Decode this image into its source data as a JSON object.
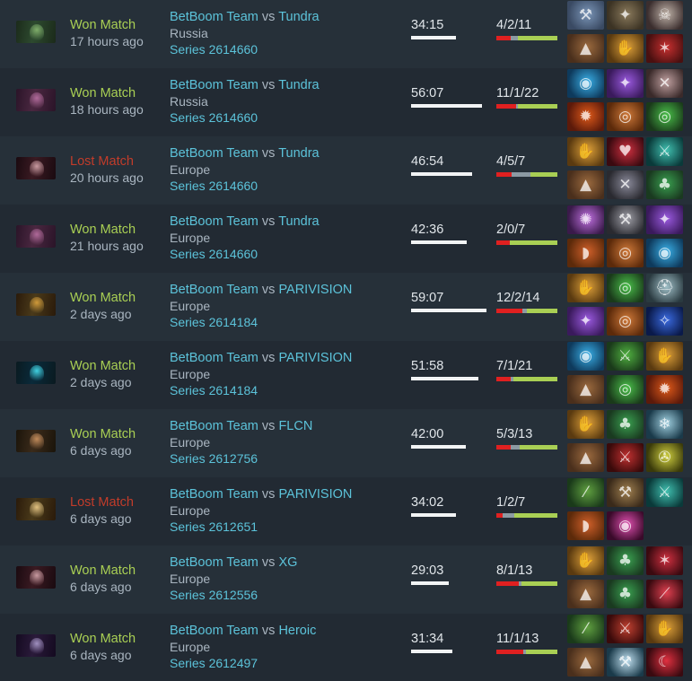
{
  "matches": [
    {
      "hero_icon": "naga-siren-icon",
      "hero_colors": [
        "#2d4a2f",
        "#7fae6a",
        "#1b2a1a"
      ],
      "result": "Won Match",
      "outcome": "win",
      "time_ago": "17 hours ago",
      "team_a": "BetBoom Team",
      "vs": "vs",
      "team_b": "Tundra",
      "region": "Russia",
      "series": "Series 2614660",
      "duration": "34:15",
      "duration_fraction": 0.56,
      "kda": "4/2/11",
      "kills": 4,
      "deaths": 2,
      "assists": 11,
      "items": [
        {
          "icon": "hammer-item-icon",
          "colors": [
            "#3a4a63",
            "#7b96b8"
          ],
          "glyph": "⚒"
        },
        {
          "icon": "glimmer-cape-icon",
          "colors": [
            "#3c3324",
            "#8a7a5c"
          ],
          "glyph": "✦"
        },
        {
          "icon": "skull-item-icon",
          "colors": [
            "#3b2e2e",
            "#bfb2a8"
          ],
          "glyph": "☠"
        },
        {
          "icon": "boots-icon",
          "colors": [
            "#4a2f1c",
            "#9b6a3e"
          ],
          "glyph": "▲"
        },
        {
          "icon": "hand-of-midas-icon",
          "colors": [
            "#5a3a10",
            "#e0a23a"
          ],
          "glyph": "✋"
        },
        {
          "icon": "red-bladed-item-icon",
          "colors": [
            "#4a1010",
            "#c93030"
          ],
          "glyph": "✶"
        }
      ]
    },
    {
      "hero_icon": "queen-of-pain-icon",
      "hero_colors": [
        "#4a2740",
        "#b06a9a",
        "#2a1428"
      ],
      "result": "Won Match",
      "outcome": "win",
      "time_ago": "18 hours ago",
      "team_a": "BetBoom Team",
      "vs": "vs",
      "team_b": "Tundra",
      "region": "Russia",
      "series": "Series 2614660",
      "duration": "56:07",
      "duration_fraction": 0.88,
      "kda": "11/1/22",
      "kills": 11,
      "deaths": 1,
      "assists": 22,
      "items": [
        {
          "icon": "blue-orb-icon",
          "colors": [
            "#0e3a5c",
            "#3ab0e8"
          ],
          "glyph": "◉"
        },
        {
          "icon": "purple-dagger-icon",
          "colors": [
            "#3a1a5c",
            "#9b5ae0"
          ],
          "glyph": "✦"
        },
        {
          "icon": "claw-item-icon",
          "colors": [
            "#3a2a2a",
            "#c0a0a0"
          ],
          "glyph": "✕"
        },
        {
          "icon": "fire-swirl-icon",
          "colors": [
            "#5c1a0a",
            "#e05a1a"
          ],
          "glyph": "✹"
        },
        {
          "icon": "orange-drum-icon",
          "colors": [
            "#5c2a0a",
            "#d07a3a"
          ],
          "glyph": "◎"
        },
        {
          "icon": "green-spiral-icon",
          "colors": [
            "#1a3a1a",
            "#4ac04a"
          ],
          "glyph": "◎"
        }
      ]
    },
    {
      "hero_icon": "anti-mage-icon",
      "hero_colors": [
        "#3a1a22",
        "#c89aa0",
        "#1a0a10"
      ],
      "result": "Lost Match",
      "outcome": "loss",
      "time_ago": "20 hours ago",
      "team_a": "BetBoom Team",
      "vs": "vs",
      "team_b": "Tundra",
      "region": "Europe",
      "series": "Series 2614660",
      "duration": "46:54",
      "duration_fraction": 0.76,
      "kda": "4/5/7",
      "kills": 4,
      "deaths": 5,
      "assists": 7,
      "items": [
        {
          "icon": "hand-of-midas-icon",
          "colors": [
            "#5a3a10",
            "#e0a23a"
          ],
          "glyph": "✋"
        },
        {
          "icon": "red-heart-icon",
          "colors": [
            "#3a0a10",
            "#d03040"
          ],
          "glyph": "♥"
        },
        {
          "icon": "teal-blade-icon",
          "colors": [
            "#0a3a3a",
            "#40c0b0"
          ],
          "glyph": "⚔"
        },
        {
          "icon": "boots-icon",
          "colors": [
            "#4a2f1c",
            "#9b6a3e"
          ],
          "glyph": "▲"
        },
        {
          "icon": "gray-dagger-icon",
          "colors": [
            "#2a2a30",
            "#8a8a9a"
          ],
          "glyph": "✕"
        },
        {
          "icon": "green-robe-icon",
          "colors": [
            "#1a3a20",
            "#3aa050"
          ],
          "glyph": "♣"
        }
      ]
    },
    {
      "hero_icon": "queen-of-pain-icon",
      "hero_colors": [
        "#4a2740",
        "#b06a9a",
        "#2a1428"
      ],
      "result": "Won Match",
      "outcome": "win",
      "time_ago": "21 hours ago",
      "team_a": "BetBoom Team",
      "vs": "vs",
      "team_b": "Tundra",
      "region": "Europe",
      "series": "Series 2614660",
      "duration": "42:36",
      "duration_fraction": 0.69,
      "kda": "2/0/7",
      "kills": 2,
      "deaths": 0,
      "assists": 7,
      "items": [
        {
          "icon": "purple-burst-icon",
          "colors": [
            "#3a1a4a",
            "#c070e0"
          ],
          "glyph": "✺"
        },
        {
          "icon": "gray-axe-icon",
          "colors": [
            "#2a2a30",
            "#a0a0a8"
          ],
          "glyph": "⚒"
        },
        {
          "icon": "purple-dagger-icon",
          "colors": [
            "#3a1a5c",
            "#9b5ae0"
          ],
          "glyph": "✦"
        },
        {
          "icon": "orange-cloak-icon",
          "colors": [
            "#5c2a0a",
            "#d0602a"
          ],
          "glyph": "◗"
        },
        {
          "icon": "orange-drum-icon",
          "colors": [
            "#5c2a0a",
            "#d07a3a"
          ],
          "glyph": "◎"
        },
        {
          "icon": "blue-orb-icon",
          "colors": [
            "#0e3a5c",
            "#3ab0e8"
          ],
          "glyph": "◉"
        }
      ]
    },
    {
      "hero_icon": "clockwerk-icon",
      "hero_colors": [
        "#4a3a1a",
        "#d09a3a",
        "#2a1a0a"
      ],
      "result": "Won Match",
      "outcome": "win",
      "time_ago": "2 days ago",
      "team_a": "BetBoom Team",
      "vs": "vs",
      "team_b": "PARIVISION",
      "region": "Europe",
      "series": "Series 2614184",
      "duration": "59:07",
      "duration_fraction": 0.93,
      "kda": "12/2/14",
      "kills": 12,
      "deaths": 2,
      "assists": 14,
      "items": [
        {
          "icon": "hand-of-midas-icon",
          "colors": [
            "#5a3a10",
            "#e0a23a"
          ],
          "glyph": "✋"
        },
        {
          "icon": "green-spiral-icon",
          "colors": [
            "#1a3a1a",
            "#4ac04a"
          ],
          "glyph": "◎"
        },
        {
          "icon": "steel-helm-icon",
          "colors": [
            "#2a3a40",
            "#a0c0c8"
          ],
          "glyph": "⛑"
        },
        {
          "icon": "purple-dagger-icon",
          "colors": [
            "#3a1a5c",
            "#9b5ae0"
          ],
          "glyph": "✦"
        },
        {
          "icon": "orange-drum-icon",
          "colors": [
            "#5c2a0a",
            "#d07a3a"
          ],
          "glyph": "◎"
        },
        {
          "icon": "blue-staff-icon",
          "colors": [
            "#0a1a4a",
            "#3a6ae0"
          ],
          "glyph": "✧"
        }
      ]
    },
    {
      "hero_icon": "storm-spirit-icon",
      "hero_colors": [
        "#0a2a3a",
        "#40d0e0",
        "#0a1a20"
      ],
      "result": "Won Match",
      "outcome": "win",
      "time_ago": "2 days ago",
      "team_a": "BetBoom Team",
      "vs": "vs",
      "team_b": "PARIVISION",
      "region": "Europe",
      "series": "Series 2614184",
      "duration": "51:58",
      "duration_fraction": 0.83,
      "kda": "7/1/21",
      "kills": 7,
      "deaths": 1,
      "assists": 21,
      "items": [
        {
          "icon": "blue-orb-icon",
          "colors": [
            "#0e3a5c",
            "#3ab0e8"
          ],
          "glyph": "◉"
        },
        {
          "icon": "green-sword-icon",
          "colors": [
            "#1a3a1a",
            "#50b040"
          ],
          "glyph": "⚔"
        },
        {
          "icon": "hand-of-midas-icon",
          "colors": [
            "#5a3a10",
            "#e0a23a"
          ],
          "glyph": "✋"
        },
        {
          "icon": "boots-icon",
          "colors": [
            "#4a2f1c",
            "#9b6a3e"
          ],
          "glyph": "▲"
        },
        {
          "icon": "green-spiral-icon",
          "colors": [
            "#1a3a1a",
            "#4ac04a"
          ],
          "glyph": "◎"
        },
        {
          "icon": "fire-swirl-icon",
          "colors": [
            "#5c1a0a",
            "#e05a1a"
          ],
          "glyph": "✹"
        }
      ]
    },
    {
      "hero_icon": "kunkka-icon",
      "hero_colors": [
        "#3a2a1a",
        "#c08a5a",
        "#1a140a"
      ],
      "result": "Won Match",
      "outcome": "win",
      "time_ago": "6 days ago",
      "team_a": "BetBoom Team",
      "vs": "vs",
      "team_b": "FLCN",
      "region": "Europe",
      "series": "Series 2612756",
      "duration": "42:00",
      "duration_fraction": 0.68,
      "kda": "5/3/13",
      "kills": 5,
      "deaths": 3,
      "assists": 13,
      "items": [
        {
          "icon": "hand-of-midas-icon",
          "colors": [
            "#5a3a10",
            "#e0a23a"
          ],
          "glyph": "✋"
        },
        {
          "icon": "green-robe-icon",
          "colors": [
            "#1a3a20",
            "#3aa050"
          ],
          "glyph": "♣"
        },
        {
          "icon": "ice-armor-icon",
          "colors": [
            "#1a3a4a",
            "#a0d0e0"
          ],
          "glyph": "❄"
        },
        {
          "icon": "boots-icon",
          "colors": [
            "#4a2f1c",
            "#9b6a3e"
          ],
          "glyph": "▲"
        },
        {
          "icon": "red-blade-icon",
          "colors": [
            "#3a0a0a",
            "#c03030"
          ],
          "glyph": "⚔"
        },
        {
          "icon": "yellow-wheel-icon",
          "colors": [
            "#3a3a0a",
            "#d0d040"
          ],
          "glyph": "✇"
        }
      ]
    },
    {
      "hero_icon": "invoker-icon",
      "hero_colors": [
        "#4a3a1a",
        "#e0c080",
        "#2a1a0a"
      ],
      "result": "Lost Match",
      "outcome": "loss",
      "time_ago": "6 days ago",
      "team_a": "BetBoom Team",
      "vs": "vs",
      "team_b": "PARIVISION",
      "region": "Europe",
      "series": "Series 2612651",
      "duration": "34:02",
      "duration_fraction": 0.55,
      "kda": "1/2/7",
      "kills": 1,
      "deaths": 2,
      "assists": 7,
      "items": [
        {
          "icon": "green-wand-icon",
          "colors": [
            "#1a3a1a",
            "#60a040"
          ],
          "glyph": "⁄"
        },
        {
          "icon": "quelling-blade-icon",
          "colors": [
            "#3a2a1a",
            "#a08050"
          ],
          "glyph": "⚒"
        },
        {
          "icon": "teal-blade-icon",
          "colors": [
            "#0a3a3a",
            "#40c0b0"
          ],
          "glyph": "⚔"
        },
        {
          "icon": "orange-cloak-icon",
          "colors": [
            "#5c2a0a",
            "#d0602a"
          ],
          "glyph": "◗"
        },
        {
          "icon": "pink-orb-icon",
          "colors": [
            "#3a0a2a",
            "#e050b0"
          ],
          "glyph": "◉"
        }
      ]
    },
    {
      "hero_icon": "anti-mage-icon",
      "hero_colors": [
        "#3a1a22",
        "#c89aa0",
        "#1a0a10"
      ],
      "result": "Won Match",
      "outcome": "win",
      "time_ago": "6 days ago",
      "team_a": "BetBoom Team",
      "vs": "vs",
      "team_b": "XG",
      "region": "Europe",
      "series": "Series 2612556",
      "duration": "29:03",
      "duration_fraction": 0.47,
      "kda": "8/1/13",
      "kills": 8,
      "deaths": 1,
      "assists": 13,
      "items": [
        {
          "icon": "hand-of-midas-icon",
          "colors": [
            "#5a3a10",
            "#e0a23a"
          ],
          "glyph": "✋"
        },
        {
          "icon": "green-robe-icon",
          "colors": [
            "#1a3a20",
            "#3aa050"
          ],
          "glyph": "♣"
        },
        {
          "icon": "red-claw-icon",
          "colors": [
            "#3a0a10",
            "#d03040"
          ],
          "glyph": "✶"
        },
        {
          "icon": "boots-icon",
          "colors": [
            "#4a2f1c",
            "#9b6a3e"
          ],
          "glyph": "▲"
        },
        {
          "icon": "green-robe-icon",
          "colors": [
            "#1a3a20",
            "#3aa050"
          ],
          "glyph": "♣"
        },
        {
          "icon": "crimson-spear-icon",
          "colors": [
            "#3a0a10",
            "#e04050"
          ],
          "glyph": "⟋"
        }
      ]
    },
    {
      "hero_icon": "templar-assassin-icon",
      "hero_colors": [
        "#2a1a3a",
        "#a090c0",
        "#140a20"
      ],
      "result": "Won Match",
      "outcome": "win",
      "time_ago": "6 days ago",
      "team_a": "BetBoom Team",
      "vs": "vs",
      "team_b": "Heroic",
      "region": "Europe",
      "series": "Series 2612497",
      "duration": "31:34",
      "duration_fraction": 0.51,
      "kda": "11/1/13",
      "kills": 11,
      "deaths": 1,
      "assists": 13,
      "items": [
        {
          "icon": "green-wand-icon",
          "colors": [
            "#1a3a1a",
            "#60a040"
          ],
          "glyph": "⁄"
        },
        {
          "icon": "red-scythe-icon",
          "colors": [
            "#3a0a0a",
            "#c04030"
          ],
          "glyph": "⚔"
        },
        {
          "icon": "hand-of-midas-icon",
          "colors": [
            "#5a3a10",
            "#e0a23a"
          ],
          "glyph": "✋"
        },
        {
          "icon": "boots-icon",
          "colors": [
            "#4a2f1c",
            "#9b6a3e"
          ],
          "glyph": "▲"
        },
        {
          "icon": "white-axe-icon",
          "colors": [
            "#1a3a4a",
            "#c0e0f0"
          ],
          "glyph": "⚒"
        },
        {
          "icon": "crimson-crescent-icon",
          "colors": [
            "#3a0a10",
            "#e03040"
          ],
          "glyph": "☾"
        }
      ]
    }
  ]
}
